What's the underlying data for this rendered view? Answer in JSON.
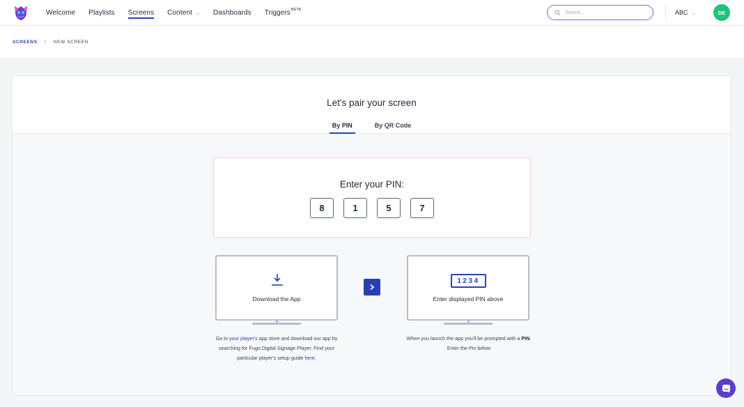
{
  "nav": {
    "items": [
      {
        "label": "Welcome"
      },
      {
        "label": "Playlists"
      },
      {
        "label": "Screens",
        "active": true
      },
      {
        "label": "Content",
        "has_caret": true
      },
      {
        "label": "Dashboards"
      },
      {
        "label": "Triggers",
        "badge": "BETA"
      }
    ]
  },
  "search": {
    "placeholder": "Search..."
  },
  "account": {
    "label": "ABC",
    "avatar_initials": "DE",
    "avatar_color": "#1ec37a"
  },
  "breadcrumb": {
    "parent": "SCREENS",
    "separator": "/",
    "current": "NEW SCREEN"
  },
  "pairing": {
    "title": "Let's pair your screen",
    "tabs": [
      {
        "label": "By PIN",
        "active": true
      },
      {
        "label": "By QR Code",
        "active": false
      }
    ],
    "pin_title": "Enter your PIN:",
    "pin_digits": [
      "8",
      "1",
      "5",
      "7"
    ]
  },
  "steps": {
    "download": {
      "label": "Download the App",
      "desc_prefix": "Go to ",
      "desc_link1": "your player's",
      "desc_mid": " app store and download our app by searching for Fugo Digital Signage Player. Find your particular player's setup guide ",
      "desc_link2": "here",
      "desc_suffix": "."
    },
    "enter_pin": {
      "label": "Enter displayed PIN above",
      "sample_pin": "1234",
      "desc_prefix": "When you launch the app you'll be prompted with a ",
      "desc_bold": "PIN",
      "desc_suffix": ". Enter the Pin below"
    }
  },
  "colors": {
    "accent": "#2741b5",
    "chat": "#5b3fc4",
    "search_border": "#6b6fd8"
  },
  "icons": {
    "logo": "fugo-logo",
    "search": "search-icon",
    "download": "download-icon",
    "next": "chevron-right-icon",
    "chat": "chat-icon"
  }
}
